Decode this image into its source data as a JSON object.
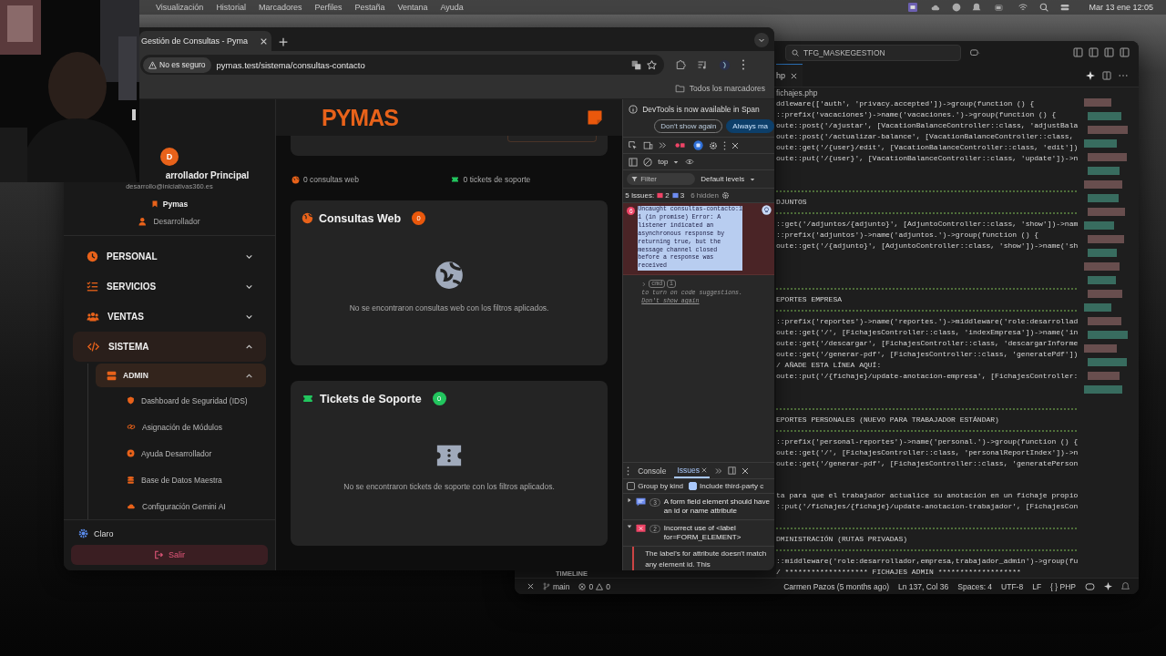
{
  "menubar": {
    "items": [
      "Visualización",
      "Historial",
      "Marcadores",
      "Perfiles",
      "Pestaña",
      "Ventana",
      "Ayuda"
    ],
    "clock": "Mar 13 ene 12:05"
  },
  "browser": {
    "tabs": [
      {
        "title": "Gestión de Consultas - Pyma",
        "selected": true
      }
    ],
    "security": "No es seguro",
    "url": "pymas.test/sistema/consultas-contacto",
    "bookmarks_label": "Todos los marcadores"
  },
  "app": {
    "logo": "PYMAS",
    "user": {
      "initial": "D",
      "name": "arrollador Principal",
      "email": "desarrollo@iniciativas360.es",
      "company": "Pymas",
      "role": "Desarrollador"
    },
    "nav": [
      {
        "label": "PERSONAL",
        "expanded": false,
        "selected": false
      },
      {
        "label": "SERVICIOS",
        "expanded": false,
        "selected": false
      },
      {
        "label": "VENTAS",
        "expanded": false,
        "selected": false
      },
      {
        "label": "SISTEMA",
        "expanded": true,
        "selected": true,
        "children": [
          {
            "label": "ADMIN",
            "expanded": true,
            "selected": true,
            "children": [
              {
                "label": "Dashboard de Seguridad (IDS)"
              },
              {
                "label": "Asignación de Módulos"
              },
              {
                "label": "Ayuda Desarrollador"
              },
              {
                "label": "Base de Datos Maestra"
              },
              {
                "label": "Configuración Gemini AI"
              }
            ]
          }
        ]
      }
    ],
    "theme_label": "Claro",
    "logout": "Salir",
    "stats": [
      {
        "text": "0 consultas web",
        "color": "#e8621a"
      },
      {
        "text": "0 tickets de soporte",
        "color": "#22c55e"
      }
    ],
    "panels": [
      {
        "kind": "web",
        "title": "Consultas Web",
        "count": "0",
        "color": "#ea580c",
        "empty": "No se encontraron consultas web con los filtros aplicados."
      },
      {
        "kind": "ticket",
        "title": "Tickets de Soporte",
        "count": "0",
        "color": "#22c55e",
        "empty": "No se encontraron tickets de soporte con los filtros aplicados."
      }
    ]
  },
  "devtools": {
    "banner": "DevTools is now available in Span",
    "banner_buttons": [
      "Don't show again",
      "Always ma"
    ],
    "context": "top",
    "filter_placeholder": "Filter",
    "levels": "Default levels",
    "issues_label": "5 Issues:",
    "error_count": "2",
    "info_count": "3",
    "hidden": "6 hidden",
    "error": {
      "count": "6",
      "message": "Uncaught consultas-contacto:1\n1 (in promise) Error: A\nlistener indicated an\nasynchronous response by\nreturning true, but the\nmessage channel closed\nbefore a response was\nreceived"
    },
    "hint": {
      "keys": [
        "cmd",
        "i"
      ],
      "text": "to turn on code suggestions.",
      "link": "Don't show again"
    },
    "drawer_tabs": [
      {
        "label": "Console",
        "selected": false
      },
      {
        "label": "Issues",
        "selected": true
      }
    ],
    "options": [
      {
        "label": "Group by kind",
        "checked": false
      },
      {
        "label": "Include third-party c",
        "checked": true
      }
    ],
    "issues": [
      {
        "kind": "info",
        "count": "3",
        "text": "A form field element should have an id or name attribute",
        "expanded": false
      },
      {
        "kind": "error",
        "count": "2",
        "text": "Incorrect use of <label for=FORM_ELEMENT>",
        "expanded": true,
        "detail": "The label's for attribute doesn't match any element id. This"
      }
    ]
  },
  "vscode": {
    "search": "TFG_MASKEGESTION",
    "tab": "hp",
    "breadcrumb": "fichajes.php",
    "panel_label": "TIMELINE",
    "branch": "main",
    "errors": "0",
    "warnings": "0",
    "status": [
      "Carmen Pazos (5 months ago)",
      "Ln 137, Col 36",
      "Spaces: 4",
      "UTF-8",
      "LF",
      "{ } PHP"
    ],
    "lines": [
      {
        "kind": "code",
        "text": "ddleware(['auth', 'privacy.accepted'])->group(function () {"
      },
      {
        "kind": "code",
        "text": "::prefix('vacaciones')->name('vacaciones.')->group(function () {"
      },
      {
        "kind": "code",
        "text": "oute::post('/ajustar', [VacationBalanceController::class, 'adjustBala"
      },
      {
        "kind": "code",
        "text": "oute::post('/actualizar-balance', [VacationBalanceController::class,"
      },
      {
        "kind": "code",
        "text": "oute::get('/{user}/edit', [VacationBalanceController::class, 'edit'])"
      },
      {
        "kind": "code",
        "text": "oute::put('/{user}', [VacationBalanceController::class, 'update'])->n"
      },
      {
        "kind": "blank"
      },
      {
        "kind": "blank"
      },
      {
        "kind": "rule"
      },
      {
        "kind": "comment",
        "text": "DJUNTOS"
      },
      {
        "kind": "rule"
      },
      {
        "kind": "code",
        "text": "::get('/adjuntos/{adjunto}', [AdjuntoController::class, 'show'])->nam"
      },
      {
        "kind": "code",
        "text": "::prefix('adjuntos')->name('adjuntos.')->group(function () {"
      },
      {
        "kind": "code",
        "text": "oute::get('/{adjunto}', [AdjuntoController::class, 'show'])->name('sh"
      },
      {
        "kind": "blank"
      },
      {
        "kind": "blank"
      },
      {
        "kind": "blank"
      },
      {
        "kind": "rule"
      },
      {
        "kind": "comment",
        "text": "EPORTES EMPRESA"
      },
      {
        "kind": "rule"
      },
      {
        "kind": "code",
        "text": "::prefix('reportes')->name('reportes.')->middleware('role:desarrollad"
      },
      {
        "kind": "code",
        "text": "oute::get('/', [FichajesController::class, 'indexEmpresa'])->name('in"
      },
      {
        "kind": "code",
        "text": "oute::get('/descargar', [FichajesController::class, 'descargarInforme"
      },
      {
        "kind": "code",
        "text": "oute::get('/generar-pdf', [FichajesController::class, 'generatePdf'])"
      },
      {
        "kind": "comment",
        "text": "/ AÑADE ESTA LÍNEA AQUÍ:"
      },
      {
        "kind": "code",
        "text": "oute::put('/{fichaje}/update-anotacion-empresa', [FichajesController:"
      },
      {
        "kind": "blank"
      },
      {
        "kind": "blank"
      },
      {
        "kind": "rule"
      },
      {
        "kind": "comment",
        "text": "EPORTES PERSONALES (NUEVO PARA TRABAJADOR ESTÁNDAR)"
      },
      {
        "kind": "rule"
      },
      {
        "kind": "code",
        "text": "::prefix('personal-reportes')->name('personal.')->group(function () {"
      },
      {
        "kind": "code",
        "text": "oute::get('/', [FichajesController::class, 'personalReportIndex'])->n"
      },
      {
        "kind": "code",
        "text": "oute::get('/generar-pdf', [FichajesController::class, 'generatePerson"
      },
      {
        "kind": "blank"
      },
      {
        "kind": "blank"
      },
      {
        "kind": "comment",
        "text": "ta para que el trabajador actualice su anotación en un fichaje propio"
      },
      {
        "kind": "code",
        "text": "::put('/fichajes/{fichaje}/update-anotacion-trabajador', [FichajesCon"
      },
      {
        "kind": "blank"
      },
      {
        "kind": "rule"
      },
      {
        "kind": "comment",
        "text": "DMINISTRACIÓN (RUTAS PRIVADAS)"
      },
      {
        "kind": "rule"
      },
      {
        "kind": "code",
        "text": "::middleware('role:desarrollador,empresa,trabajador_admin')->group(fu"
      },
      {
        "kind": "comment",
        "text": "/ ******************* FICHAJES ADMIN *******************"
      }
    ]
  }
}
